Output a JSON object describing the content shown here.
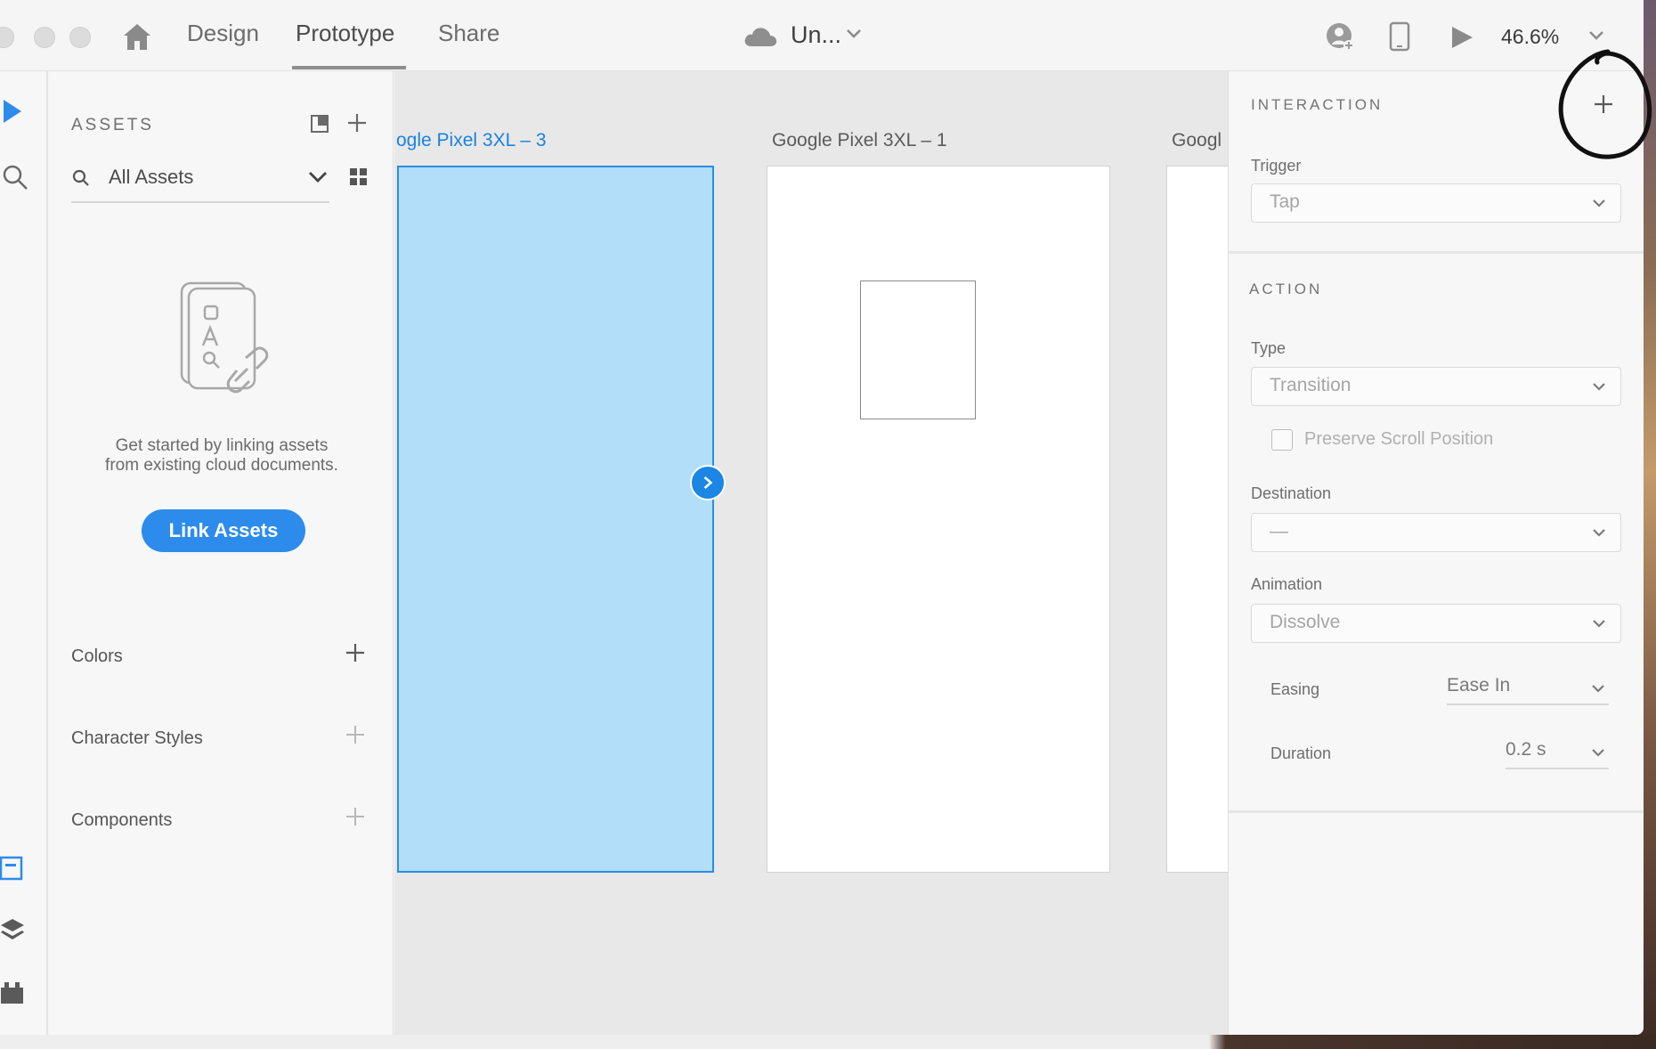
{
  "titlebar": {
    "tabs": [
      {
        "label": "Design",
        "active": false
      },
      {
        "label": "Prototype",
        "active": true
      },
      {
        "label": "Share",
        "active": false
      }
    ],
    "doc_title": "Un...",
    "zoom": "46.6%"
  },
  "assets": {
    "title": "ASSETS",
    "search_label": "All Assets",
    "empty_text_line1": "Get started by linking assets",
    "empty_text_line2": "from existing cloud documents.",
    "link_button": "Link Assets",
    "sections": [
      {
        "label": "Colors"
      },
      {
        "label": "Character Styles"
      },
      {
        "label": "Components"
      }
    ]
  },
  "canvas": {
    "artboards": [
      {
        "label": "ogle Pixel 3XL – 3",
        "selected": true
      },
      {
        "label": "Google Pixel 3XL – 1",
        "selected": false
      },
      {
        "label": "Googl",
        "selected": false
      }
    ]
  },
  "inspector": {
    "interaction_heading": "INTERACTION",
    "trigger_label": "Trigger",
    "trigger_value": "Tap",
    "action_heading": "ACTION",
    "type_label": "Type",
    "type_value": "Transition",
    "preserve_scroll_label": "Preserve Scroll Position",
    "destination_label": "Destination",
    "destination_value": "—",
    "animation_label": "Animation",
    "animation_value": "Dissolve",
    "easing_label": "Easing",
    "easing_value": "Ease In",
    "duration_label": "Duration",
    "duration_value": "0.2 s"
  },
  "colors": {
    "accent": "#2d8ceb",
    "selection_fill": "#b3def9",
    "selection_label": "#1a82e2"
  }
}
